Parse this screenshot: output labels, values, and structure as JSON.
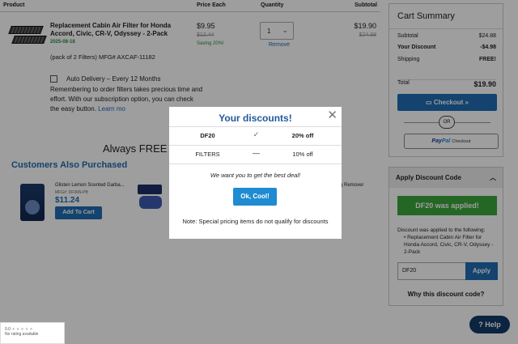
{
  "table": {
    "headers": {
      "product": "Product",
      "price_each": "Price Each",
      "quantity": "Quantity",
      "subtotal": "Subtotal"
    }
  },
  "item": {
    "title": "Replacement Cabin Air Filter for Honda Accord, Civic, CR-V, Odyssey - 2-Pack",
    "date": "2025-08-18",
    "meta": "(pack of 2 Filters)   MFG# AXCAF-11182",
    "price": "$9.95",
    "price_was": "$12.44",
    "saving": "Saving 20%!",
    "quantity": "1",
    "remove": "Remove",
    "subtotal": "$19.90",
    "subtotal_was": "$24.88"
  },
  "auto_delivery": {
    "label": "Auto Delivery – Every 12 Months",
    "text": "Remembering to order filters takes precious time and effort. With our subscription option, you can check the easy button.",
    "link": "Learn mo"
  },
  "free_shipping": "Always FREE S",
  "also_purchased": {
    "heading": "Customers Also Purchased",
    "items": [
      {
        "title": "Glisten Lemon Scented Garba...",
        "mfg": "MFG#: DF06N-PB",
        "price": "$11.24",
        "button": "Add To Cart"
      },
      {
        "title": "g Remover"
      }
    ]
  },
  "summary": {
    "title": "Cart Summary",
    "rows": [
      {
        "label": "Subtotal",
        "value": "$24.88"
      },
      {
        "label": "Your Discount",
        "value": "-$4.98"
      },
      {
        "label": "Shipping",
        "value": "FREE!"
      },
      {
        "label": "Total",
        "value": "$19.90"
      }
    ],
    "checkout": "Checkout »",
    "or": "OR",
    "paypal_1": "Pay",
    "paypal_2": "Pal",
    "paypal_3": "Checkout"
  },
  "discount_panel": {
    "heading": "Apply Discount Code",
    "applied": "DF20 was applied!",
    "note": "Discount was applied to the following:",
    "item": "Replacement Cabin Air Filter for Honda Accord, Civic, CR-V, Odyssey - 2-Pack",
    "input_value": "DF20",
    "apply": "Apply",
    "why": "Why this discount code?"
  },
  "modal": {
    "title": "Your discounts!",
    "close": "✕",
    "rows": [
      {
        "code": "DF20",
        "status": "✓",
        "amount": "20% off"
      },
      {
        "code": "FILTERS",
        "status": "—",
        "amount": "10% off"
      }
    ],
    "message": "We want you to get the best deal!",
    "button": "Ok, Cool!",
    "note": "Note: Special pricing items do not qualify for discounts"
  },
  "help": "Help",
  "rating": {
    "score": "0.0",
    "stars": "★★★★★",
    "text": "No rating available"
  },
  "colors": {
    "brand": "#1f6db2",
    "success": "#3aa63a",
    "overlay": "rgba(0,0,0,0.38)"
  }
}
